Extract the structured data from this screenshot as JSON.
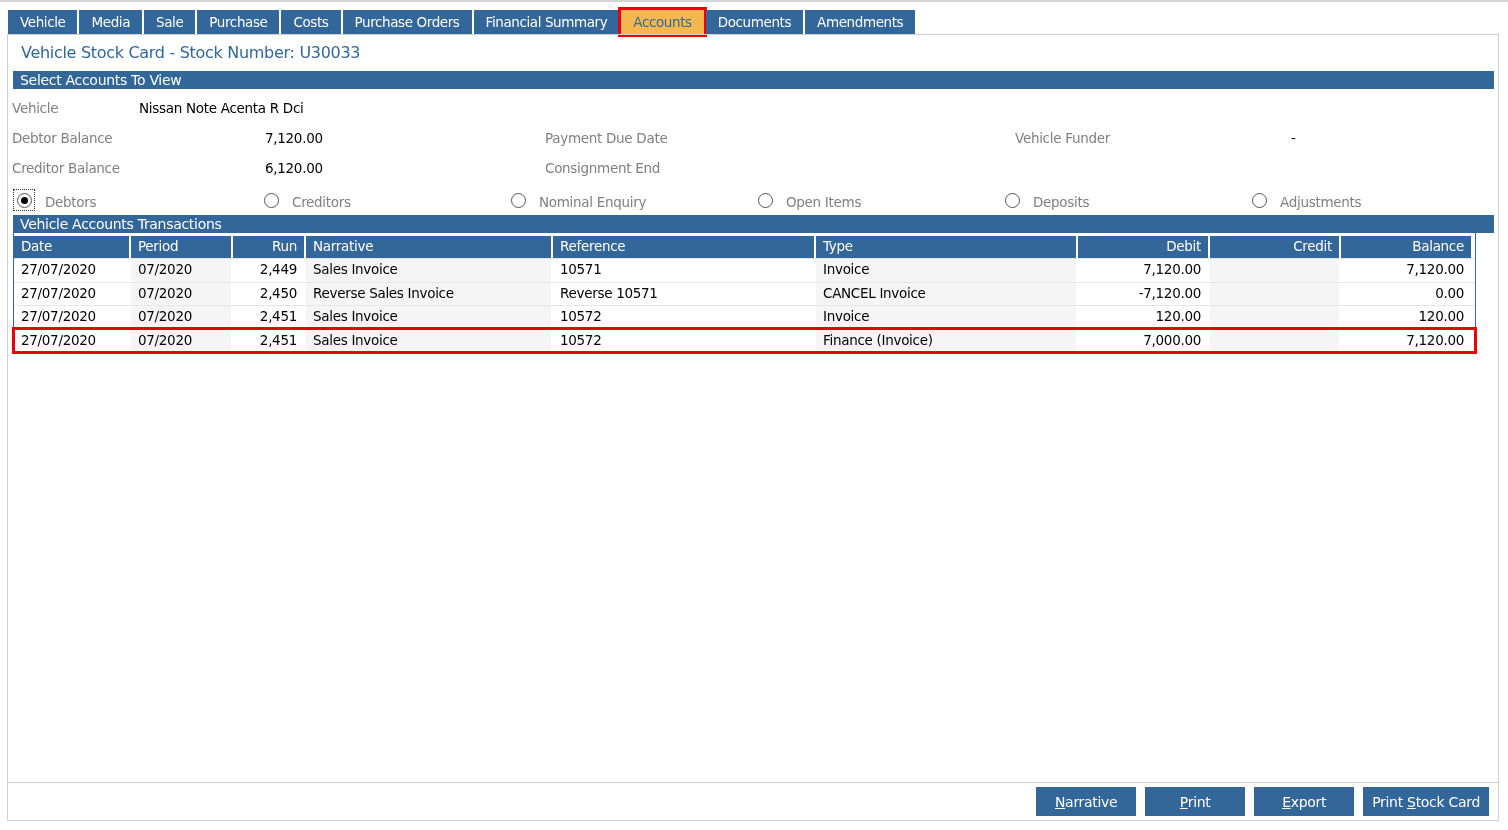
{
  "tabs": [
    {
      "label": "Vehicle",
      "selected": false,
      "highlighted": false
    },
    {
      "label": "Media",
      "selected": false,
      "highlighted": false
    },
    {
      "label": "Sale",
      "selected": false,
      "highlighted": false
    },
    {
      "label": "Purchase",
      "selected": false,
      "highlighted": false
    },
    {
      "label": "Costs",
      "selected": false,
      "highlighted": false
    },
    {
      "label": "Purchase Orders",
      "selected": false,
      "highlighted": false
    },
    {
      "label": "Financial Summary",
      "selected": false,
      "highlighted": false
    },
    {
      "label": "Accounts",
      "selected": true,
      "highlighted": true
    },
    {
      "label": "Documents",
      "selected": false,
      "highlighted": false
    },
    {
      "label": "Amendments",
      "selected": false,
      "highlighted": false
    }
  ],
  "page_title": "Vehicle Stock Card - Stock Number: U30033",
  "select_section": {
    "title": "Select Accounts To View",
    "vehicle": {
      "label": "Vehicle",
      "value": "Nissan Note Acenta R Dci"
    },
    "fields": [
      {
        "label": "Debtor Balance",
        "value": "7,120.00"
      },
      {
        "label": "Payment Due Date"
      },
      {
        "label": "Vehicle Funder",
        "value": "-"
      },
      {
        "label": "Creditor Balance",
        "value": "6,120.00"
      },
      {
        "label": "Consignment End"
      }
    ],
    "options": [
      {
        "label": "Debtors",
        "selected": true
      },
      {
        "label": "Creditors",
        "selected": false
      },
      {
        "label": "Nominal Enquiry",
        "selected": false
      },
      {
        "label": "Open Items",
        "selected": false
      },
      {
        "label": "Deposits",
        "selected": false
      },
      {
        "label": "Adjustments",
        "selected": false
      }
    ]
  },
  "transactions": {
    "title": "Vehicle Accounts Transactions",
    "columns": [
      {
        "label": "Date",
        "kind": "text"
      },
      {
        "label": "Period",
        "kind": "text"
      },
      {
        "label": "Run",
        "kind": "number"
      },
      {
        "label": "Narrative",
        "kind": "text"
      },
      {
        "label": "Reference",
        "kind": "text"
      },
      {
        "label": "Type",
        "kind": "text"
      },
      {
        "label": "Debit",
        "kind": "number"
      },
      {
        "label": "Credit",
        "kind": "number"
      },
      {
        "label": "Balance",
        "kind": "number"
      }
    ],
    "rows": [
      {
        "highlighted": false,
        "cells": [
          "27/07/2020",
          "07/2020",
          "2,449",
          "Sales Invoice",
          "10571",
          "Invoice",
          "7,120.00",
          null,
          "7,120.00"
        ]
      },
      {
        "highlighted": false,
        "cells": [
          "27/07/2020",
          "07/2020",
          "2,450",
          "Reverse Sales Invoice",
          "Reverse 10571",
          "CANCEL Invoice",
          "-7,120.00",
          null,
          "0.00"
        ]
      },
      {
        "highlighted": false,
        "cells": [
          "27/07/2020",
          "07/2020",
          "2,451",
          "Sales Invoice",
          "10572",
          "Invoice",
          "120.00",
          null,
          "120.00"
        ]
      },
      {
        "highlighted": true,
        "cells": [
          "27/07/2020",
          "07/2020",
          "2,451",
          "Sales Invoice",
          "10572",
          "Finance (Invoice)",
          "7,000.00",
          null,
          "7,120.00"
        ]
      }
    ]
  },
  "buttons": [
    {
      "key": "N",
      "after": "arrative"
    },
    {
      "key": "P",
      "after": "rint"
    },
    {
      "key": "E",
      "after": "xport"
    },
    {
      "before": "Print ",
      "key": "S",
      "after": "tock Card"
    }
  ]
}
